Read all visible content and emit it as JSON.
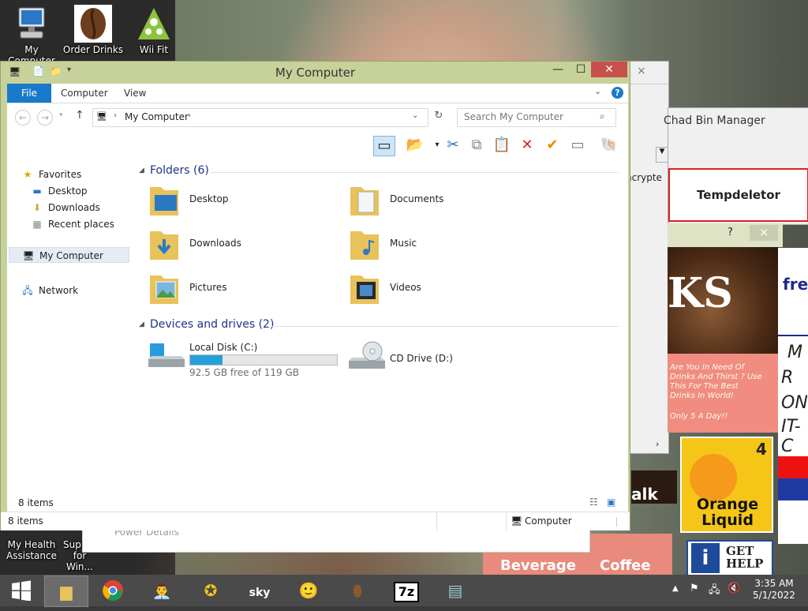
{
  "desktop": {
    "icons": [
      {
        "label": "My Computer"
      },
      {
        "label": "Order Drinks"
      },
      {
        "label": "Wii Fit"
      }
    ],
    "bottom_icons": [
      {
        "label": "My Health Assistance"
      },
      {
        "label": "Sup 64 for Win..."
      }
    ]
  },
  "background_windows": {
    "bin_manager_title": "Chad Bin Manager",
    "encrypt_label": "ncrypte",
    "tempdeletor_button": "Tempdeletor",
    "help_glyph": "?",
    "close_glyph": "×",
    "power_details": "Power Details",
    "right_ad_text": "fre",
    "right_ad_letters": [
      "M",
      "R",
      "ON",
      "IT-C"
    ]
  },
  "drinks_ad": {
    "banner": "KS",
    "pitch": "Are You In Need Of Drinks And Thirst ? Use This For The Best Drinks In World!",
    "price": "Only 5 A Day!!",
    "tile_orange_number": "4",
    "tile_orange_label": "Orange Liquid",
    "tile_walk": "alk",
    "tile_beverage": "Beverage",
    "tile_coffee": "Coffee",
    "get_help": "GET HELP",
    "info_icon": "i"
  },
  "explorer": {
    "title": "My Computer",
    "window_buttons": {
      "minimize": "—",
      "maximize": "☐",
      "close": "✕"
    },
    "ribbon_tabs": [
      "File",
      "Computer",
      "View"
    ],
    "help_icon": "?",
    "address": {
      "path": "My Computer"
    },
    "search": {
      "placeholder": "Search My Computer"
    },
    "nav": {
      "favorites": "Favorites",
      "favorite_items": [
        "Desktop",
        "Downloads",
        "Recent places"
      ],
      "my_computer": "My Computer",
      "network": "Network"
    },
    "folders_header": "Folders (6)",
    "folders": [
      {
        "name": "Desktop"
      },
      {
        "name": "Documents"
      },
      {
        "name": "Downloads"
      },
      {
        "name": "Music"
      },
      {
        "name": "Pictures"
      },
      {
        "name": "Videos"
      }
    ],
    "drives_header": "Devices and drives (2)",
    "local_disk": {
      "name": "Local Disk (C:)",
      "free_text": "92.5 GB free of 119 GB",
      "used_fraction": 0.22
    },
    "cd_drive": {
      "name": "CD Drive (D:)"
    },
    "item_count_inner": "8 items",
    "status": {
      "count": "8 items",
      "location": "Computer"
    }
  },
  "taskbar": {
    "clock_time": "3:35 AM",
    "clock_date": "5/1/2022",
    "seven_zip": "7z"
  },
  "colors": {
    "accent": "#1979ca",
    "explorer_frame": "#c7d19a",
    "close_red": "#c7504a",
    "ad_pink": "#f08c80",
    "progress_blue": "#26a0da"
  }
}
